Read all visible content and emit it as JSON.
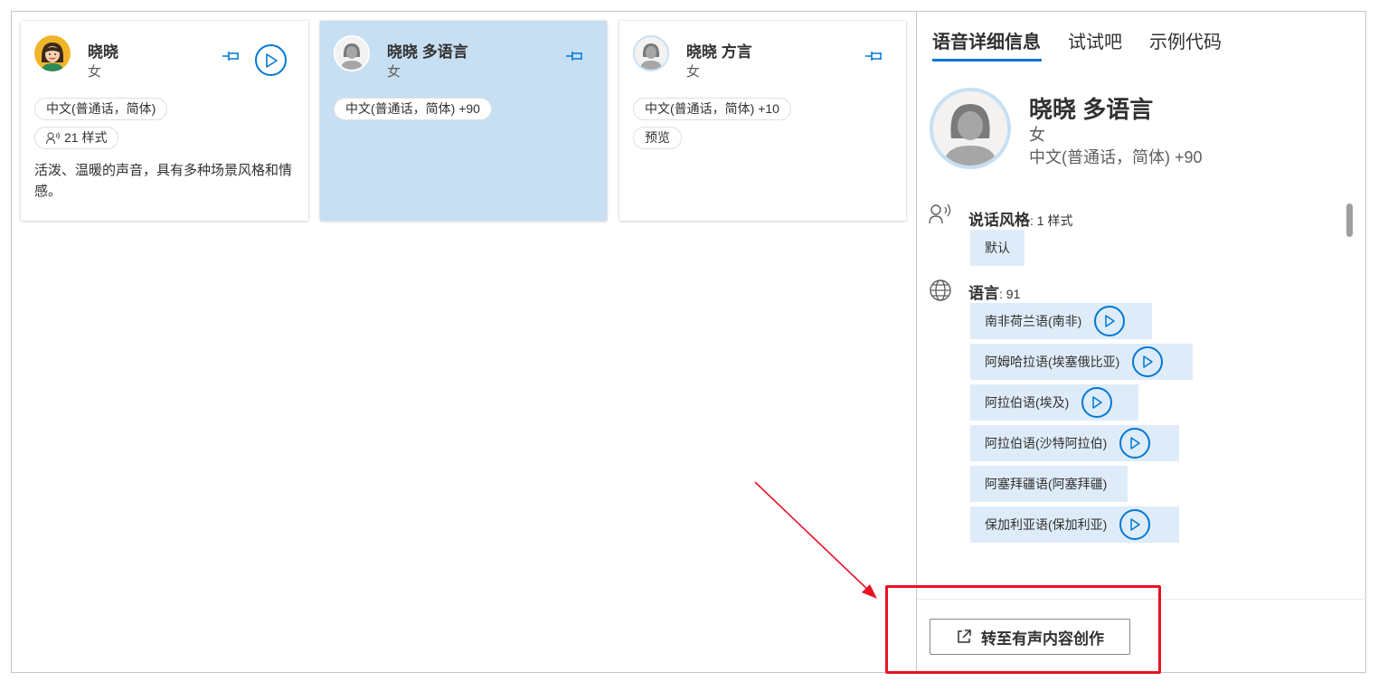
{
  "cards": [
    {
      "name": "晓晓",
      "gender": "女",
      "tags": [
        "中文(普通话，简体)"
      ],
      "styles_badge": "21 样式",
      "description": "活泼、温暖的声音，具有多种场景风格和情感。",
      "selected": false,
      "avatar": "illustrated-avatar",
      "has_play": true
    },
    {
      "name": "晓晓 多语言",
      "gender": "女",
      "tags": [
        "中文(普通话，简体) +90"
      ],
      "selected": true,
      "avatar": "generic-female-avatar",
      "has_play": false
    },
    {
      "name": "晓晓 方言",
      "gender": "女",
      "tags": [
        "中文(普通话，简体) +10",
        "预览"
      ],
      "selected": false,
      "avatar": "generic-female-avatar",
      "has_play": false
    }
  ],
  "panel": {
    "tabs": [
      "语音详细信息",
      "试试吧",
      "示例代码"
    ],
    "active_tab": 0,
    "detail": {
      "name": "晓晓 多语言",
      "gender": "女",
      "language": "中文(普通话，简体) +90",
      "style_label": "说话风格",
      "style_count": ": 1 样式",
      "styles": [
        "默认"
      ],
      "language_label": "语言",
      "language_count": ": 91",
      "languages": [
        {
          "label": "南非荷兰语(南非)",
          "playable": true
        },
        {
          "label": "阿姆哈拉语(埃塞俄比亚)",
          "playable": true
        },
        {
          "label": "阿拉伯语(埃及)",
          "playable": true
        },
        {
          "label": "阿拉伯语(沙特阿拉伯)",
          "playable": true
        },
        {
          "label": "阿塞拜疆语(阿塞拜疆)",
          "playable": false
        },
        {
          "label": "保加利亚语(保加利亚)",
          "playable": true
        }
      ]
    },
    "action_button": "转至有声内容创作"
  },
  "colors": {
    "accent": "#0078d4",
    "selected_bg": "#c7dff3",
    "chip_bg": "#deecf9",
    "annotation": "#e81123"
  },
  "icons": {
    "pin": "pin-icon",
    "play": "play-icon",
    "voice": "voice-style-icon",
    "globe": "globe-icon",
    "external": "open-external-icon"
  }
}
